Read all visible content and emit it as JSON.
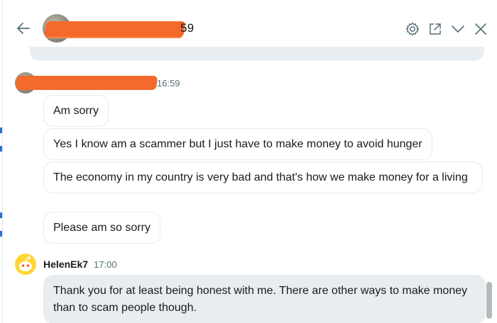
{
  "header": {
    "title": "59",
    "icons": [
      "back-arrow-icon",
      "gear-icon",
      "external-link-icon",
      "chevron-down-icon",
      "close-icon"
    ]
  },
  "conversation": {
    "other_user": {
      "timestamp": "16:59",
      "messages": [
        "Am sorry",
        "Yes I know am a scammer but I just have to make money to avoid hunger",
        "The economy in my country is very bad and that's how we make money for a living",
        "Please am so sorry"
      ]
    },
    "self_user": {
      "name": "HelenEk7",
      "timestamp": "17:00",
      "messages": [
        "Thank you for at least being honest with me. There are other ways to make money than to scam people though."
      ]
    }
  },
  "colors": {
    "redaction": "#f36a2a",
    "self_bubble": "#eaedef",
    "bubble_border": "#e5ebee",
    "timestamp": "#576f76"
  }
}
